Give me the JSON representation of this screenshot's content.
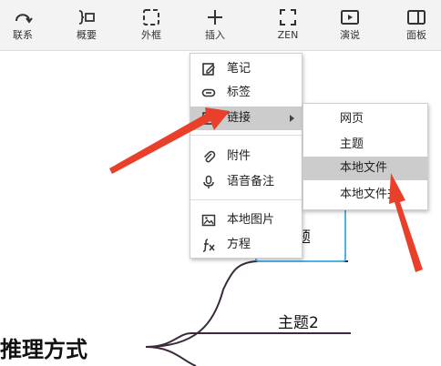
{
  "toolbar": {
    "items": [
      {
        "label": "联系",
        "icon": "relation-arc-icon"
      },
      {
        "label": "概要",
        "icon": "summary-bracket-icon"
      },
      {
        "label": "外框",
        "icon": "boundary-frame-icon"
      },
      {
        "label": "插入",
        "icon": "plus-icon"
      },
      {
        "label": "ZEN",
        "icon": "zen-fullscreen-icon"
      },
      {
        "label": "演说",
        "icon": "presentation-play-icon"
      },
      {
        "label": "面板",
        "icon": "panel-sidebar-icon"
      }
    ]
  },
  "mindmap": {
    "root_label": "推理方式",
    "topic2_label": "主题2",
    "topic_above_fragment": "题"
  },
  "insert_menu": {
    "items": [
      {
        "label": "笔记",
        "icon": "note-edit-icon"
      },
      {
        "label": "标签",
        "icon": "tag-label-icon"
      },
      {
        "label": "链接",
        "icon": "link-icon",
        "has_submenu": true,
        "active": true
      },
      {
        "label": "附件",
        "icon": "paperclip-icon"
      },
      {
        "label": "语音备注",
        "icon": "microphone-icon"
      },
      {
        "label": "本地图片",
        "icon": "image-icon"
      },
      {
        "label": "方程",
        "icon": "equation-fx-icon"
      }
    ]
  },
  "link_submenu": {
    "items": [
      {
        "label": "网页"
      },
      {
        "label": "主题"
      },
      {
        "label": "本地文件",
        "active": true
      },
      {
        "label": "本地文件夹"
      }
    ]
  },
  "colors": {
    "toolbar_bg": "#f3f3f3",
    "menu_active_bg": "#cccccc",
    "selection_border": "#4fb3e8",
    "connector": "#3a2a3c",
    "annotation_arrow": "#e8402a"
  }
}
